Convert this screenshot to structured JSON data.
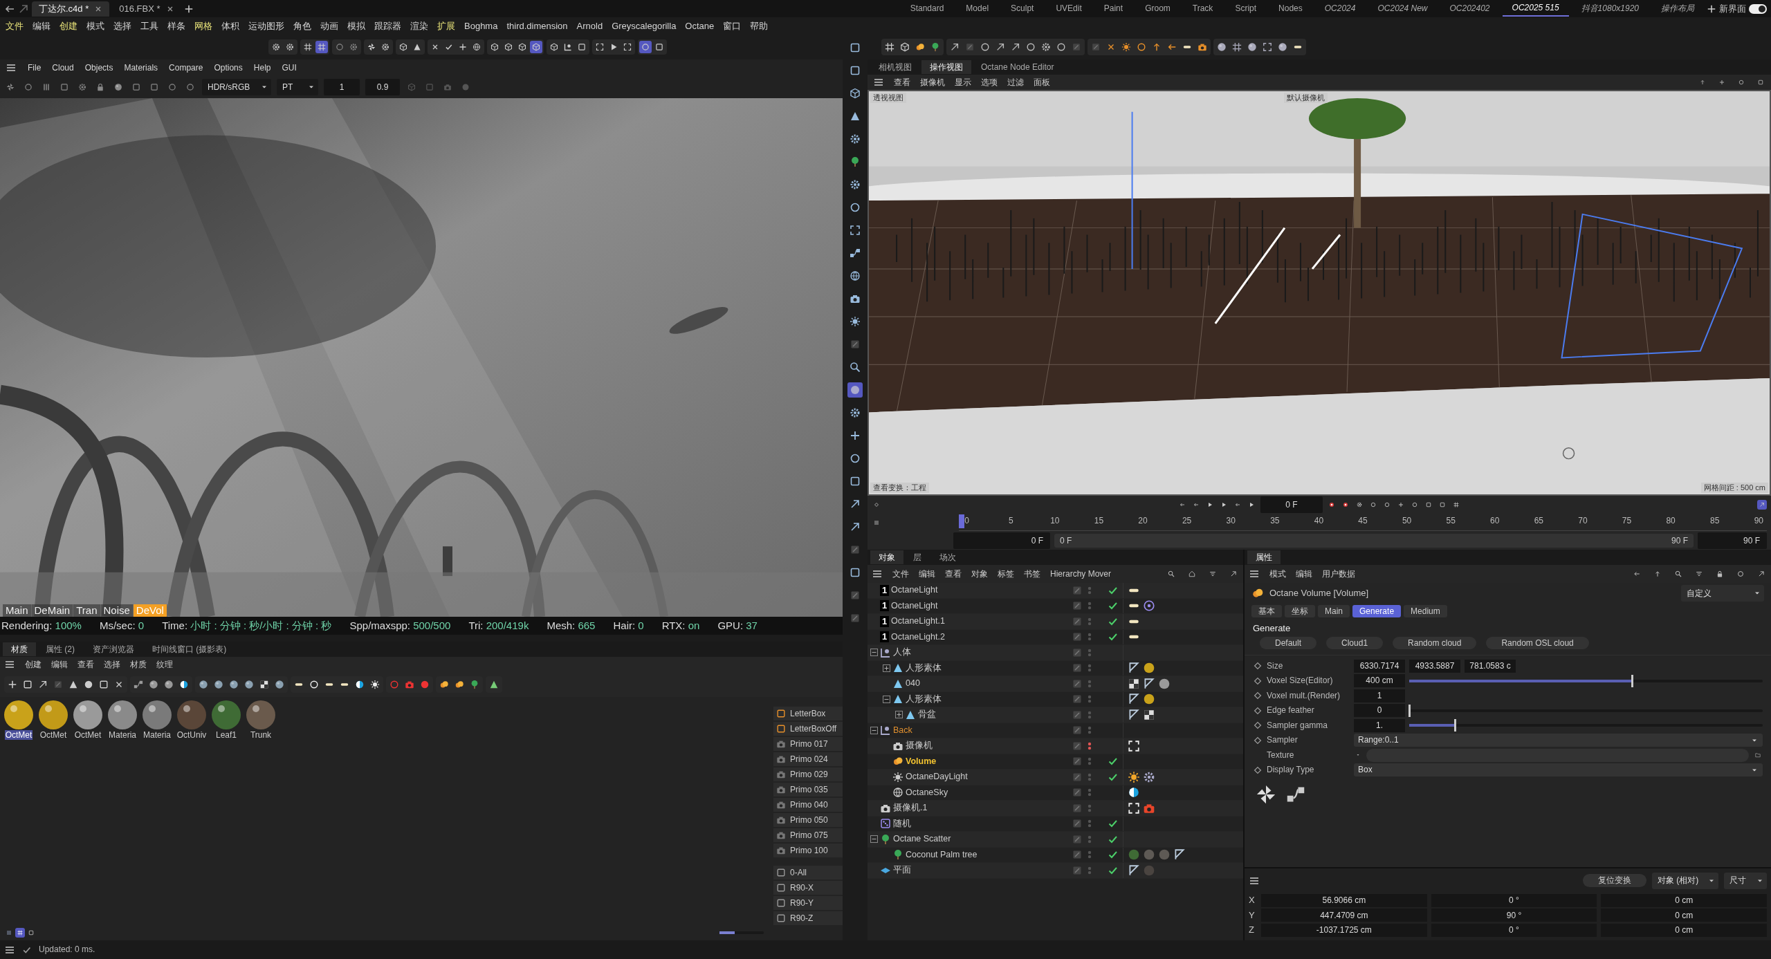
{
  "file_tabs": [
    {
      "label": "丁达尔.c4d *",
      "selected": true
    },
    {
      "label": "016.FBX *",
      "selected": false
    }
  ],
  "layouts": [
    {
      "label": "Standard",
      "selected": false
    },
    {
      "label": "Model",
      "selected": false
    },
    {
      "label": "Sculpt",
      "selected": false
    },
    {
      "label": "UVEdit",
      "selected": false
    },
    {
      "label": "Paint",
      "selected": false
    },
    {
      "label": "Groom",
      "selected": false
    },
    {
      "label": "Track",
      "selected": false
    },
    {
      "label": "Script",
      "selected": false
    },
    {
      "label": "Nodes",
      "selected": false
    },
    {
      "label": "OC2024",
      "selected": false
    },
    {
      "label": "OC2024 New",
      "selected": false
    },
    {
      "label": "OC202402",
      "selected": false
    },
    {
      "label": "OC2025 515",
      "selected": true
    },
    {
      "label": "抖音1080x1920",
      "selected": false
    },
    {
      "label": "操作布局",
      "selected": false
    }
  ],
  "layout_toggle": {
    "label": "新界面",
    "on": true
  },
  "menu": [
    {
      "label": "文件",
      "highlighted": true
    },
    {
      "label": "编辑",
      "highlighted": false
    },
    {
      "label": "创建",
      "highlighted": true
    },
    {
      "label": "模式",
      "highlighted": false
    },
    {
      "label": "选择",
      "highlighted": false
    },
    {
      "label": "工具",
      "highlighted": false
    },
    {
      "label": "样条",
      "highlighted": false
    },
    {
      "label": "网格",
      "highlighted": true
    },
    {
      "label": "体积",
      "highlighted": false
    },
    {
      "label": "运动图形",
      "highlighted": false
    },
    {
      "label": "角色",
      "highlighted": false
    },
    {
      "label": "动画",
      "highlighted": false
    },
    {
      "label": "模拟",
      "highlighted": false
    },
    {
      "label": "跟踪器",
      "highlighted": false
    },
    {
      "label": "渲染",
      "highlighted": false
    },
    {
      "label": "扩展",
      "highlighted": true
    },
    {
      "label": "Boghma",
      "highlighted": false
    },
    {
      "label": "third.dimension",
      "highlighted": false
    },
    {
      "label": "Arnold",
      "highlighted": false
    },
    {
      "label": "Greyscalegorilla",
      "highlighted": false
    },
    {
      "label": "Octane",
      "highlighted": false
    },
    {
      "label": "窗口",
      "highlighted": false
    },
    {
      "label": "帮助",
      "highlighted": false
    }
  ],
  "octane": {
    "menu": [
      "File",
      "Cloud",
      "Objects",
      "Materials",
      "Compare",
      "Options",
      "Help",
      "GUI"
    ],
    "display_mode": "HDR/sRGB",
    "kernel": "PT",
    "field_1": "1",
    "field_2": "0.9",
    "render_tabs": [
      {
        "label": "Main",
        "selected": false
      },
      {
        "label": "DeMain",
        "selected": false
      },
      {
        "label": "Tran",
        "selected": false
      },
      {
        "label": "Noise",
        "selected": false
      },
      {
        "label": "DeVol",
        "selected": true
      }
    ],
    "stats": [
      {
        "label": "Rendering:",
        "value": "100%"
      },
      {
        "label": "Ms/sec:",
        "value": "0"
      },
      {
        "label": "Time:",
        "value": "小时 : 分钟 : 秒/小时 : 分钟 : 秒"
      },
      {
        "label": "Spp/maxspp:",
        "value": "500/500"
      },
      {
        "label": "Tri:",
        "value": "200/419k"
      },
      {
        "label": "Mesh:",
        "value": "665"
      },
      {
        "label": "Hair:",
        "value": "0"
      },
      {
        "label": "RTX:",
        "value": "on"
      },
      {
        "label": "GPU:",
        "value": "37"
      }
    ]
  },
  "materials": {
    "tabs": [
      {
        "label": "材质",
        "selected": true
      },
      {
        "label": "属性 (2)",
        "selected": false
      },
      {
        "label": "资产浏览器",
        "selected": false
      },
      {
        "label": "时间线窗口 (摄影表)",
        "selected": false
      }
    ],
    "menu": [
      "创建",
      "编辑",
      "查看",
      "选择",
      "材质",
      "纹理"
    ],
    "items": [
      {
        "label": "OctMet",
        "color": "#c9a21a",
        "selected": true
      },
      {
        "label": "OctMet",
        "color": "#c29a18",
        "selected": false
      },
      {
        "label": "OctMet",
        "color": "#9a9a9a",
        "selected": false
      },
      {
        "label": "Materia",
        "color": "#8a8a8a",
        "selected": false
      },
      {
        "label": "Materia",
        "color": "#7a7a7a",
        "selected": false
      },
      {
        "label": "OctUniv",
        "color": "#5a4638",
        "selected": false
      },
      {
        "label": "Leaf1",
        "color": "#3f6b35",
        "selected": false
      },
      {
        "label": "Trunk",
        "color": "#6a5a4c",
        "selected": false
      }
    ],
    "presets": [
      "LetterBox",
      "LetterBoxOff",
      "Primo 017",
      "Primo 024",
      "Primo 029",
      "Primo 035",
      "Primo 040",
      "Primo 050",
      "Primo 075",
      "Primo 100"
    ],
    "rotations": [
      "0-All",
      "R90-X",
      "R90-Y",
      "R90-Z"
    ],
    "zoom": {
      "level": 0.35
    }
  },
  "viewport": {
    "tabs": [
      {
        "label": "相机视图",
        "selected": false
      },
      {
        "label": "操作视图",
        "selected": true
      },
      {
        "label": "Octane Node Editor",
        "selected": false
      }
    ],
    "menu": [
      "查看",
      "摄像机",
      "显示",
      "选项",
      "过滤",
      "面板"
    ],
    "view_name": "透视视图",
    "camera": "默认摄像机",
    "transform": "查看变换：工程",
    "grid_spacing": "网格间距 : 500 cm"
  },
  "timeline": {
    "current_frame": "0 F",
    "ticks": [
      "0",
      "5",
      "10",
      "15",
      "20",
      "25",
      "30",
      "35",
      "40",
      "45",
      "50",
      "55",
      "60",
      "65",
      "70",
      "75",
      "80",
      "85",
      "90"
    ],
    "start": "0 F",
    "range_start": "0 F",
    "range_end": "90 F",
    "end": "90 F"
  },
  "objects": {
    "tabs": [
      {
        "label": "对象",
        "selected": true
      },
      {
        "label": "层",
        "selected": false
      },
      {
        "label": "场次",
        "selected": false
      }
    ],
    "menu": [
      "文件",
      "编辑",
      "查看",
      "对象",
      "标签",
      "书签",
      "Hierarchy Mover"
    ],
    "items": [
      {
        "name": "OctaneLight",
        "badge": "1",
        "selected": false,
        "visible": true,
        "enabled": true,
        "tags": [
          {
            "kind": "lamp"
          }
        ]
      },
      {
        "name": "OctaneLight",
        "badge": "1",
        "selected": false,
        "visible": true,
        "enabled": true,
        "tags": [
          {
            "kind": "lamp"
          },
          {
            "kind": "target"
          }
        ]
      },
      {
        "name": "OctaneLight.1",
        "badge": "1",
        "selected": false,
        "visible": true,
        "enabled": true,
        "tags": [
          {
            "kind": "lamp"
          }
        ]
      },
      {
        "name": "OctaneLight.2",
        "badge": "1",
        "selected": false,
        "visible": true,
        "enabled": true,
        "tags": [
          {
            "kind": "lamp"
          }
        ]
      },
      {
        "name": "人体",
        "kind": "null",
        "selected": false,
        "visible": true,
        "expanded": true,
        "children": [
          {
            "name": "人形素体",
            "kind": "figure",
            "selected": false,
            "visible": true,
            "expanded": false,
            "tags": [
              {
                "kind": "flag"
              },
              {
                "kind": "gold"
              }
            ]
          },
          {
            "name": "040",
            "kind": "figure",
            "selected": false,
            "visible": true,
            "tags": [
              {
                "kind": "checker"
              },
              {
                "kind": "flag"
              },
              {
                "kind": "silver"
              }
            ]
          },
          {
            "name": "人形素体",
            "kind": "figure",
            "selected": false,
            "visible": true,
            "expanded": true,
            "tags": [
              {
                "kind": "flag"
              },
              {
                "kind": "gold"
              }
            ],
            "children": [
              {
                "name": "骨盆",
                "kind": "figure",
                "selected": false,
                "visible": true,
                "expanded": false,
                "tags": [
                  {
                    "kind": "flag"
                  },
                  {
                    "kind": "checker"
                  }
                ]
              }
            ]
          }
        ]
      },
      {
        "name": "Back",
        "kind": "null",
        "color": "#e0902f",
        "selected": false,
        "visible": true,
        "expanded": true,
        "children": [
          {
            "name": "摄像机",
            "kind": "camera",
            "selected": false,
            "visible": false,
            "tags": [
              {
                "kind": "frame"
              }
            ]
          },
          {
            "name": "Volume",
            "kind": "volume",
            "selected": true,
            "visible": true,
            "enabled": true
          },
          {
            "name": "OctaneDayLight",
            "kind": "daylight",
            "selected": false,
            "visible": true,
            "enabled": true,
            "tags": [
              {
                "kind": "sun"
              },
              {
                "kind": "gear"
              }
            ]
          },
          {
            "name": "OctaneSky",
            "kind": "sky",
            "selected": false,
            "visible": true,
            "tags": [
              {
                "kind": "half"
              }
            ]
          }
        ]
      },
      {
        "name": "摄像机.1",
        "kind": "camera",
        "selected": false,
        "visible": true,
        "tags": [
          {
            "kind": "frame"
          },
          {
            "kind": "camera"
          }
        ]
      },
      {
        "name": "随机",
        "kind": "random",
        "selected": false,
        "visible": true,
        "enabled": true
      },
      {
        "name": "Octane Scatter",
        "kind": "scatter",
        "selected": false,
        "visible": true,
        "enabled": true,
        "expanded": true,
        "children": [
          {
            "name": "Coconut Palm tree",
            "kind": "tree",
            "selected": false,
            "visible": true,
            "enabled": true,
            "tags": [
              {
                "kind": "leaf"
              },
              {
                "kind": "bark"
              },
              {
                "kind": "bark"
              },
              {
                "kind": "flag"
              }
            ]
          }
        ]
      },
      {
        "name": "平面",
        "kind": "plane",
        "selected": false,
        "visible": true,
        "enabled": true,
        "tags": [
          {
            "kind": "flag"
          },
          {
            "kind": "dark"
          }
        ]
      }
    ]
  },
  "attributes": {
    "tab": "属性",
    "menu": [
      "模式",
      "编辑",
      "用户数据"
    ],
    "title": "Octane Volume [Volume]",
    "preset_mode": "自定义",
    "tabs": [
      {
        "label": "基本",
        "selected": false
      },
      {
        "label": "坐标",
        "selected": false
      },
      {
        "label": "Main",
        "selected": false
      },
      {
        "label": "Generate",
        "selected": true
      },
      {
        "label": "Medium",
        "selected": false
      }
    ],
    "section": "Generate",
    "presets": [
      "Default",
      "Cloud1",
      "Random cloud",
      "Random OSL cloud"
    ],
    "params": [
      {
        "kind": "vector",
        "label": "Size",
        "values": [
          "6330.7174",
          "4933.5887",
          "781.0583 c"
        ]
      },
      {
        "kind": "slider",
        "label": "Voxel Size(Editor)",
        "value": "400 cm",
        "level": 0.63
      },
      {
        "kind": "number",
        "label": "Voxel mult.(Render)",
        "value": "1"
      },
      {
        "kind": "slider",
        "label": "Edge feather",
        "value": "0",
        "level": 0
      },
      {
        "kind": "slider",
        "label": "Sampler gamma",
        "value": "1.",
        "level": 0.13
      },
      {
        "kind": "dropdown",
        "label": "Sampler",
        "value": "Range:0..1"
      },
      {
        "kind": "texture",
        "label": "Texture"
      },
      {
        "kind": "dropdown",
        "label": "Display Type",
        "value": "Box"
      }
    ]
  },
  "coordinates": {
    "reset": "复位变换",
    "mode": "对象 (相对)",
    "size_mode": "尺寸",
    "rows": [
      {
        "axis": "X",
        "position": "56.9066 cm",
        "rotation": "0 °",
        "size": "0 cm"
      },
      {
        "axis": "Y",
        "position": "447.4709 cm",
        "rotation": "90 °",
        "size": "0 cm"
      },
      {
        "axis": "Z",
        "position": "-1037.1725 cm",
        "rotation": "0 °",
        "size": "0 cm"
      }
    ]
  },
  "status": "Updated: 0 ms."
}
